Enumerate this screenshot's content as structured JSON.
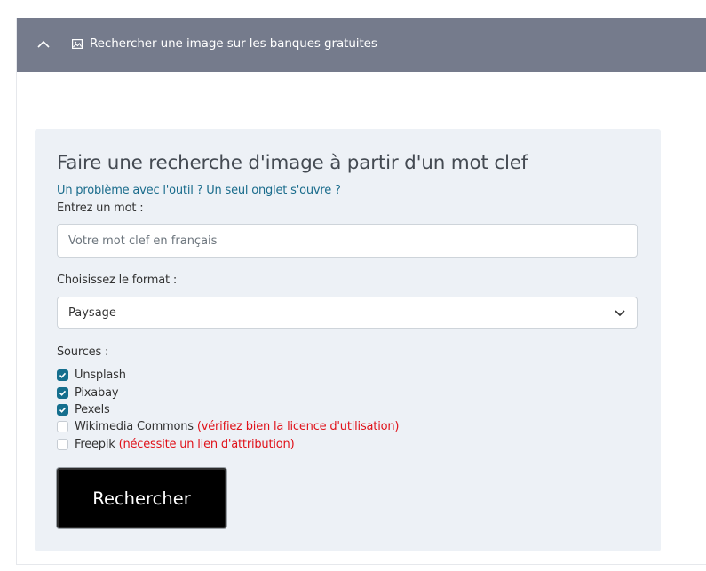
{
  "accordion": {
    "title": "Rechercher une image sur les banques gratuites",
    "icon": "image-icon",
    "toggle_icon": "chevron-up-icon",
    "header_color": "#757b8c"
  },
  "form": {
    "title": "Faire une recherche d'image à partir d'un mot clef",
    "help_link": "Un problème avec l'outil ? Un seul onglet s'ouvre ?",
    "keyword_label": "Entrez un mot :",
    "keyword_placeholder": "Votre mot clef en français",
    "keyword_value": "",
    "format_label": "Choisissez le format :",
    "format_selected": "Paysage",
    "sources_label": "Sources :",
    "sources": [
      {
        "label": "Unsplash",
        "checked": true,
        "note": ""
      },
      {
        "label": "Pixabay",
        "checked": true,
        "note": ""
      },
      {
        "label": "Pexels",
        "checked": true,
        "note": ""
      },
      {
        "label": "Wikimedia Commons",
        "checked": false,
        "note": "(vérifiez bien la licence d'utilisation)"
      },
      {
        "label": "Freepik",
        "checked": false,
        "note": "(nécessite un lien d'attribution)"
      }
    ],
    "submit_label": "Rechercher"
  },
  "colors": {
    "accent": "#156f8e",
    "link": "#1a6c8c",
    "warning": "#e0121a",
    "card_bg": "#edf1f6"
  }
}
